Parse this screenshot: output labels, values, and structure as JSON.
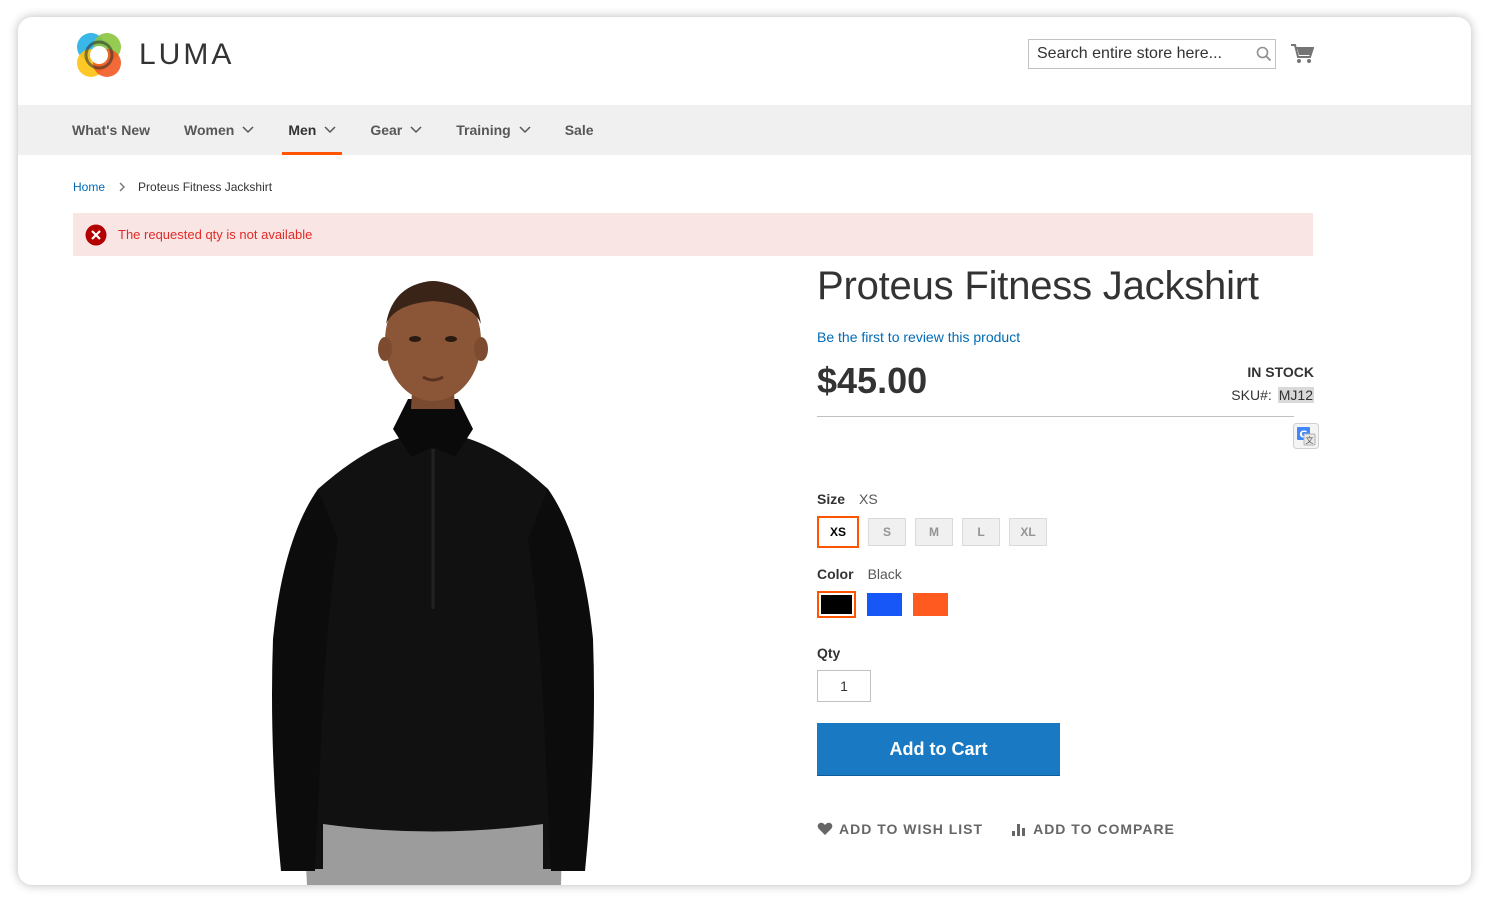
{
  "header": {
    "logo_text": "LUMA",
    "search_placeholder": "Search entire store here..."
  },
  "nav": {
    "items": [
      {
        "label": "What's New",
        "has_dropdown": false,
        "active": false
      },
      {
        "label": "Women",
        "has_dropdown": true,
        "active": false
      },
      {
        "label": "Men",
        "has_dropdown": true,
        "active": true
      },
      {
        "label": "Gear",
        "has_dropdown": true,
        "active": false
      },
      {
        "label": "Training",
        "has_dropdown": true,
        "active": false
      },
      {
        "label": "Sale",
        "has_dropdown": false,
        "active": false
      }
    ]
  },
  "breadcrumb": {
    "home": "Home",
    "current": "Proteus Fitness Jackshirt"
  },
  "message": {
    "text": "The requested qty is not available",
    "type": "error"
  },
  "product": {
    "title": "Proteus Fitness Jackshirt",
    "review_link": "Be the first to review this product",
    "price": "$45.00",
    "stock": "In stock",
    "sku_label": "SKU#:",
    "sku": "MJ12",
    "size_label": "Size",
    "size_selected": "XS",
    "sizes": [
      "XS",
      "S",
      "M",
      "L",
      "XL"
    ],
    "color_label": "Color",
    "color_selected": "Black",
    "colors": [
      {
        "name": "Black",
        "hex": "#000000"
      },
      {
        "name": "Blue",
        "hex": "#1857f7"
      },
      {
        "name": "Orange",
        "hex": "#ff5a1f"
      }
    ],
    "qty_label": "Qty",
    "qty_value": "1",
    "add_to_cart": "Add to Cart",
    "wishlist": "Add to Wish List",
    "compare": "Add to Compare"
  },
  "colors": {
    "accent": "#ff5501",
    "link": "#006bb4",
    "button": "#1979c3",
    "error_bg": "#fae5e5",
    "error_text": "#e02b27"
  }
}
